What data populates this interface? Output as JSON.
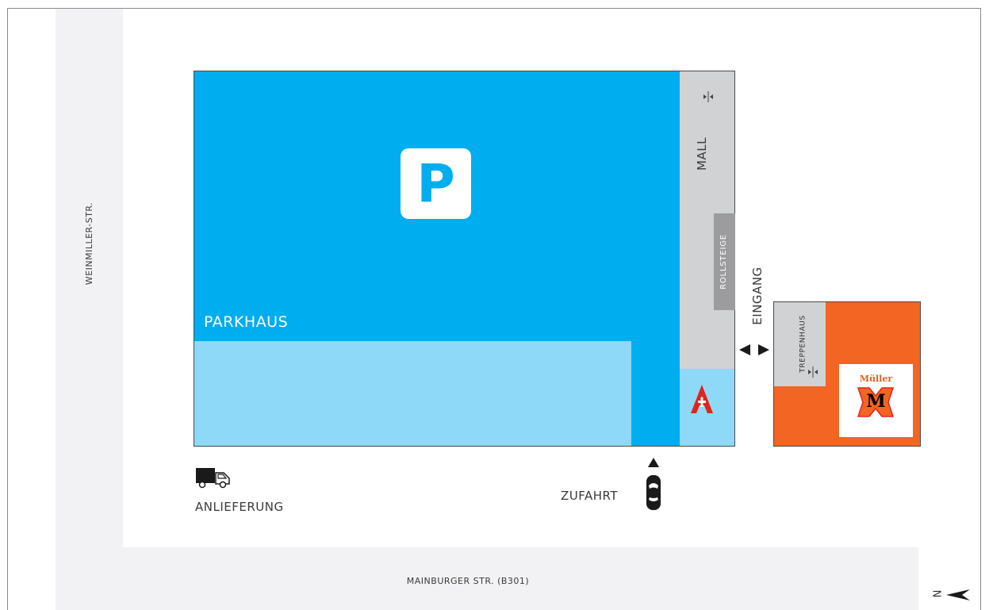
{
  "streets": {
    "west": "WEINMILLER-STR.",
    "south": "MAINBURGER STR. (B301)"
  },
  "buildings": {
    "parkhaus": "PARKHAUS",
    "parking_sign": "P",
    "mall": "MALL",
    "rollsteige": "ROLLSTEIGE",
    "treppenhaus": "TREPPENHAUS",
    "eingang": "EINGANG"
  },
  "labels": {
    "anlieferung": "ANLIEFERUNG",
    "zufahrt": "ZUFAHRT"
  },
  "store_logo": {
    "brand": "Müller",
    "letter": "M"
  },
  "compass": {
    "letter": "N"
  },
  "colors": {
    "parkhaus_blue": "#00adef",
    "light_blue": "#8ed8f8",
    "mall_gray": "#d1d2d4",
    "escalator_gray": "#9c9c9f",
    "store_orange": "#f26522",
    "road_gray": "#f2f2f4",
    "pharmacy_red": "#e2231a"
  },
  "icons": [
    "delivery-truck-icon",
    "car-icon",
    "arrow-up-icon",
    "double-arrow-icon",
    "escalator-icon",
    "pharmacy-icon",
    "north-arrow-icon"
  ]
}
